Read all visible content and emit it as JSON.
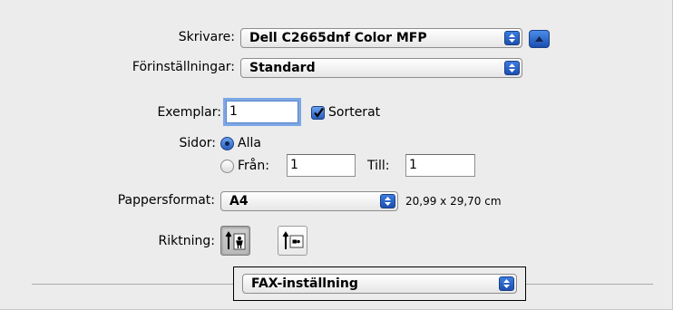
{
  "printer": {
    "label": "Skrivare:",
    "value": "Dell C2665dnf Color MFP"
  },
  "presets": {
    "label": "Förinställningar:",
    "value": "Standard"
  },
  "copies": {
    "label": "Exemplar:",
    "value": "1",
    "collate_label": "Sorterat",
    "collate_checked": true
  },
  "pages": {
    "label": "Sidor:",
    "all_label": "Alla",
    "from_label": "Från:",
    "from_value": "1",
    "to_label": "Till:",
    "to_value": "1",
    "selected": "all"
  },
  "paper": {
    "label": "Pappersformat:",
    "value": "A4",
    "dimensions": "20,99 x 29,70 cm"
  },
  "orientation": {
    "label": "Riktning:",
    "selected": "portrait"
  },
  "section": {
    "value": "FAX-inställning"
  },
  "colors": {
    "accent": "#2a5fbf",
    "panel": "#ececec"
  }
}
